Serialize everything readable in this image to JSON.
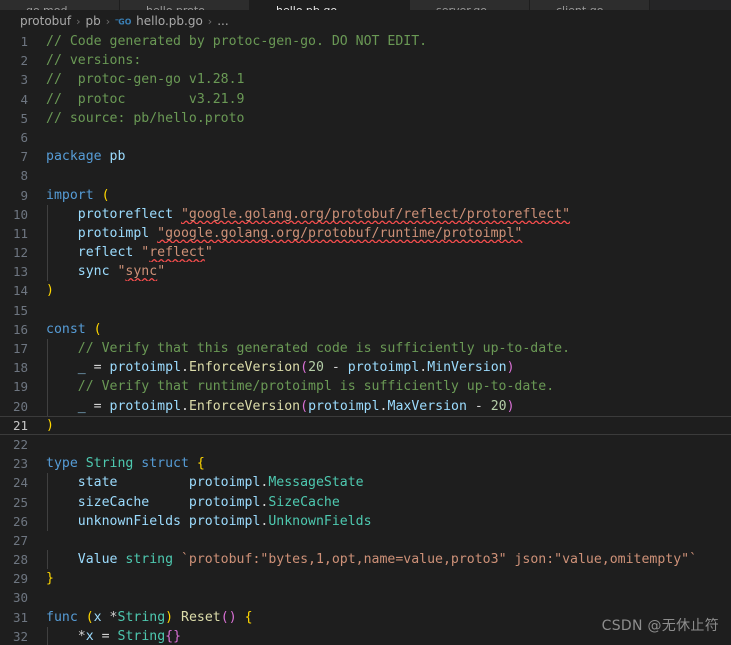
{
  "tabs": [
    {
      "label": "go.mod",
      "icon": "go-mod-icon",
      "active": false,
      "width": 120
    },
    {
      "label": "hello.proto",
      "icon": "proto-icon",
      "active": false,
      "width": 130
    },
    {
      "label": "hello.pb.go",
      "icon": "go-icon",
      "active": true,
      "width": 160
    },
    {
      "label": "server.go",
      "icon": "go-icon",
      "active": false,
      "width": 120
    },
    {
      "label": "client.go",
      "icon": "go-icon",
      "active": false,
      "width": 120
    }
  ],
  "breadcrumb": {
    "items": [
      "protobuf",
      "pb",
      "hello.pb.go",
      "..."
    ],
    "file_icon": "go-file-icon",
    "separator": "›"
  },
  "editor": {
    "active_line": 21,
    "first_line": 1,
    "last_line": 32,
    "lines": [
      {
        "n": 1,
        "indent": 0,
        "tokens": [
          {
            "t": "// Code generated by protoc-gen-go. DO NOT EDIT.",
            "c": "c"
          }
        ]
      },
      {
        "n": 2,
        "indent": 0,
        "tokens": [
          {
            "t": "// versions:",
            "c": "c"
          }
        ]
      },
      {
        "n": 3,
        "indent": 0,
        "tokens": [
          {
            "t": "//  protoc-gen-go v1.28.1",
            "c": "c"
          }
        ]
      },
      {
        "n": 4,
        "indent": 0,
        "tokens": [
          {
            "t": "//  protoc        v3.21.9",
            "c": "c"
          }
        ]
      },
      {
        "n": 5,
        "indent": 0,
        "tokens": [
          {
            "t": "// source: pb/hello.proto",
            "c": "c"
          }
        ]
      },
      {
        "n": 6,
        "indent": 0,
        "tokens": []
      },
      {
        "n": 7,
        "indent": 0,
        "tokens": [
          {
            "t": "package ",
            "c": "kw"
          },
          {
            "t": "pb",
            "c": "id"
          }
        ]
      },
      {
        "n": 8,
        "indent": 0,
        "tokens": []
      },
      {
        "n": 9,
        "indent": 0,
        "tokens": [
          {
            "t": "import ",
            "c": "kw"
          },
          {
            "t": "(",
            "c": "p1"
          }
        ]
      },
      {
        "n": 10,
        "indent": 1,
        "tokens": [
          {
            "t": "    protoreflect ",
            "c": "id"
          },
          {
            "t": "\"google.golang.org/protobuf/reflect/protoreflect\"",
            "c": "str",
            "e": true
          }
        ]
      },
      {
        "n": 11,
        "indent": 1,
        "tokens": [
          {
            "t": "    protoimpl ",
            "c": "id"
          },
          {
            "t": "\"google.golang.org/protobuf/runtime/protoimpl\"",
            "c": "str",
            "e": true
          }
        ]
      },
      {
        "n": 12,
        "indent": 1,
        "tokens": [
          {
            "t": "    reflect ",
            "c": "id"
          },
          {
            "t": "\"",
            "c": "str"
          },
          {
            "t": "reflect",
            "c": "str",
            "e": true
          },
          {
            "t": "\"",
            "c": "str"
          }
        ]
      },
      {
        "n": 13,
        "indent": 1,
        "tokens": [
          {
            "t": "    sync ",
            "c": "id"
          },
          {
            "t": "\"",
            "c": "str"
          },
          {
            "t": "sync",
            "c": "str",
            "e": true
          },
          {
            "t": "\"",
            "c": "str"
          }
        ]
      },
      {
        "n": 14,
        "indent": 0,
        "tokens": [
          {
            "t": ")",
            "c": "p1"
          }
        ]
      },
      {
        "n": 15,
        "indent": 0,
        "tokens": []
      },
      {
        "n": 16,
        "indent": 0,
        "tokens": [
          {
            "t": "const ",
            "c": "kw"
          },
          {
            "t": "(",
            "c": "p1"
          }
        ]
      },
      {
        "n": 17,
        "indent": 1,
        "tokens": [
          {
            "t": "    // Verify that this generated code is sufficiently up-to-date.",
            "c": "c"
          }
        ]
      },
      {
        "n": 18,
        "indent": 1,
        "tokens": [
          {
            "t": "    ",
            "c": "op"
          },
          {
            "t": "_",
            "c": "id"
          },
          {
            "t": " = ",
            "c": "op"
          },
          {
            "t": "protoimpl",
            "c": "id"
          },
          {
            "t": ".",
            "c": "op"
          },
          {
            "t": "EnforceVersion",
            "c": "fn"
          },
          {
            "t": "(",
            "c": "p2"
          },
          {
            "t": "20",
            "c": "num"
          },
          {
            "t": " - ",
            "c": "op"
          },
          {
            "t": "protoimpl",
            "c": "id"
          },
          {
            "t": ".",
            "c": "op"
          },
          {
            "t": "MinVersion",
            "c": "id"
          },
          {
            "t": ")",
            "c": "p2"
          }
        ]
      },
      {
        "n": 19,
        "indent": 1,
        "tokens": [
          {
            "t": "    // Verify that runtime/protoimpl is sufficiently up-to-date.",
            "c": "c"
          }
        ]
      },
      {
        "n": 20,
        "indent": 1,
        "tokens": [
          {
            "t": "    ",
            "c": "op"
          },
          {
            "t": "_",
            "c": "id"
          },
          {
            "t": " = ",
            "c": "op"
          },
          {
            "t": "protoimpl",
            "c": "id"
          },
          {
            "t": ".",
            "c": "op"
          },
          {
            "t": "EnforceVersion",
            "c": "fn"
          },
          {
            "t": "(",
            "c": "p2"
          },
          {
            "t": "protoimpl",
            "c": "id"
          },
          {
            "t": ".",
            "c": "op"
          },
          {
            "t": "MaxVersion",
            "c": "id"
          },
          {
            "t": " - ",
            "c": "op"
          },
          {
            "t": "20",
            "c": "num"
          },
          {
            "t": ")",
            "c": "p2"
          }
        ]
      },
      {
        "n": 21,
        "indent": 0,
        "tokens": [
          {
            "t": ")",
            "c": "p1"
          }
        ]
      },
      {
        "n": 22,
        "indent": 0,
        "tokens": []
      },
      {
        "n": 23,
        "indent": 0,
        "tokens": [
          {
            "t": "type ",
            "c": "kw"
          },
          {
            "t": "String ",
            "c": "typ"
          },
          {
            "t": "struct ",
            "c": "kw"
          },
          {
            "t": "{",
            "c": "p1"
          }
        ]
      },
      {
        "n": 24,
        "indent": 1,
        "tokens": [
          {
            "t": "    state         ",
            "c": "id"
          },
          {
            "t": "protoimpl",
            "c": "id"
          },
          {
            "t": ".",
            "c": "op"
          },
          {
            "t": "MessageState",
            "c": "typ"
          }
        ]
      },
      {
        "n": 25,
        "indent": 1,
        "tokens": [
          {
            "t": "    sizeCache     ",
            "c": "id"
          },
          {
            "t": "protoimpl",
            "c": "id"
          },
          {
            "t": ".",
            "c": "op"
          },
          {
            "t": "SizeCache",
            "c": "typ"
          }
        ]
      },
      {
        "n": 26,
        "indent": 1,
        "tokens": [
          {
            "t": "    unknownFields ",
            "c": "id"
          },
          {
            "t": "protoimpl",
            "c": "id"
          },
          {
            "t": ".",
            "c": "op"
          },
          {
            "t": "UnknownFields",
            "c": "typ"
          }
        ]
      },
      {
        "n": 27,
        "indent": 1,
        "tokens": []
      },
      {
        "n": 28,
        "indent": 1,
        "tokens": [
          {
            "t": "    Value ",
            "c": "id"
          },
          {
            "t": "string ",
            "c": "typ"
          },
          {
            "t": "`protobuf:\"bytes,1,opt,name=value,proto3\" json:\"value,omitempty\"`",
            "c": "str"
          }
        ]
      },
      {
        "n": 29,
        "indent": 0,
        "tokens": [
          {
            "t": "}",
            "c": "p1"
          }
        ]
      },
      {
        "n": 30,
        "indent": 0,
        "tokens": []
      },
      {
        "n": 31,
        "indent": 0,
        "tokens": [
          {
            "t": "func ",
            "c": "kw"
          },
          {
            "t": "(",
            "c": "p1"
          },
          {
            "t": "x ",
            "c": "id"
          },
          {
            "t": "*",
            "c": "op"
          },
          {
            "t": "String",
            "c": "typ"
          },
          {
            "t": ")",
            "c": "p1"
          },
          {
            "t": " ",
            "c": "op"
          },
          {
            "t": "Reset",
            "c": "fn"
          },
          {
            "t": "(",
            "c": "p2"
          },
          {
            "t": ")",
            "c": "p2"
          },
          {
            "t": " ",
            "c": "op"
          },
          {
            "t": "{",
            "c": "p1"
          }
        ]
      },
      {
        "n": 32,
        "indent": 1,
        "tokens": [
          {
            "t": "    ",
            "c": "op"
          },
          {
            "t": "*",
            "c": "op"
          },
          {
            "t": "x",
            "c": "id"
          },
          {
            "t": " = ",
            "c": "op"
          },
          {
            "t": "String",
            "c": "typ"
          },
          {
            "t": "{",
            "c": "p2"
          },
          {
            "t": "}",
            "c": "p2"
          }
        ]
      }
    ]
  },
  "watermark": {
    "text": "CSDN @无休止符"
  },
  "colors": {
    "background": "#1e1e1e",
    "tab_inactive": "#2d2d2d",
    "tab_bar": "#252526",
    "line_number": "#6e7681",
    "line_number_active": "#c6c6c6",
    "comment": "#6A9955",
    "keyword": "#569CD6",
    "identifier": "#9CDCFE",
    "string": "#CE9178",
    "type": "#4EC9B0",
    "function": "#DCDCAA",
    "number": "#B5CEA8",
    "bracket1": "#FFD700",
    "bracket2": "#DA70D6",
    "error_squiggle": "#f14c4c",
    "indent_guide": "#404040"
  }
}
